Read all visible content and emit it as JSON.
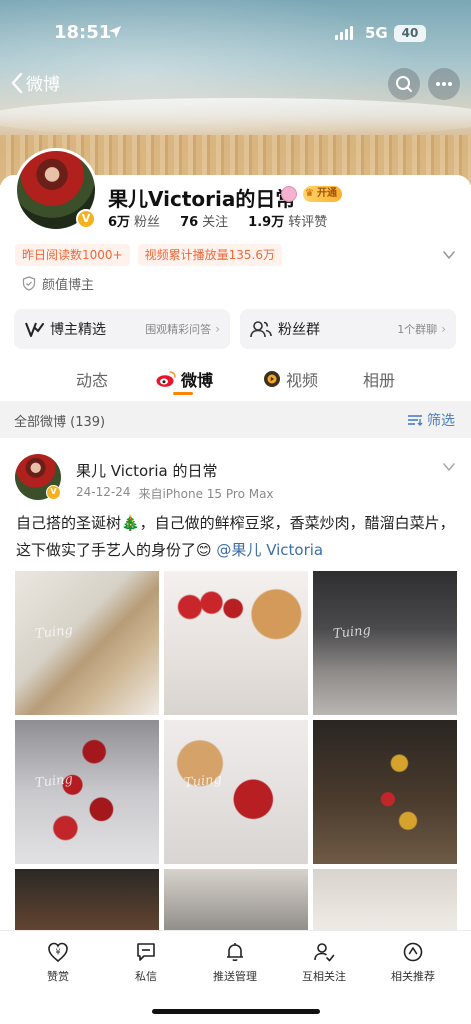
{
  "status_bar": {
    "time": "18:51",
    "network": "5G",
    "battery": "40"
  },
  "nav": {
    "back_label": "微博",
    "search_icon": "search-icon",
    "more_icon": "more-icon"
  },
  "profile": {
    "name": "果儿Victoria的日常",
    "vip_badge": "开通",
    "followers_num": "6万",
    "followers_label": "粉丝",
    "following_num": "76",
    "following_label": "关注",
    "interactions_num": "1.9万",
    "interactions_label": "转评赞",
    "tags": [
      "昨日阅读数1000+",
      "视频累计播放量135.6万"
    ],
    "role": "颜值博主"
  },
  "modules": [
    {
      "title": "博主精选",
      "subtitle": "围观精彩问答"
    },
    {
      "title": "粉丝群",
      "subtitle": "1个群聊"
    }
  ],
  "tabs": [
    {
      "label": "动态"
    },
    {
      "label": "微博"
    },
    {
      "label": "视频"
    },
    {
      "label": "相册"
    }
  ],
  "filter_bar": {
    "count_label": "全部微博 (139)",
    "filter_label": "筛选"
  },
  "post": {
    "author": "果儿 Victoria 的日常",
    "date": "24-12-24",
    "source": "来自iPhone 15 Pro Max",
    "text": "自己搭的圣诞树🎄，自己做的鲜榨豆浆，香菜炒肉，醋溜白菜片，这下做实了手艺人的身份了😊",
    "mention": "@果儿 Victoria",
    "watermarks": [
      "Tuing",
      "Tuing",
      "Tuing",
      "Tuing"
    ]
  },
  "bottom_bar": [
    {
      "label": "赞赏",
      "icon": "reward-icon"
    },
    {
      "label": "私信",
      "icon": "message-icon"
    },
    {
      "label": "推送管理",
      "icon": "bell-icon"
    },
    {
      "label": "互相关注",
      "icon": "mutual-follow-icon"
    },
    {
      "label": "相关推荐",
      "icon": "compass-icon"
    }
  ],
  "colors": {
    "accent": "#ff8200",
    "link": "#3c6ea8",
    "tag_text": "#f0693a",
    "verified": "#f6b11f"
  }
}
